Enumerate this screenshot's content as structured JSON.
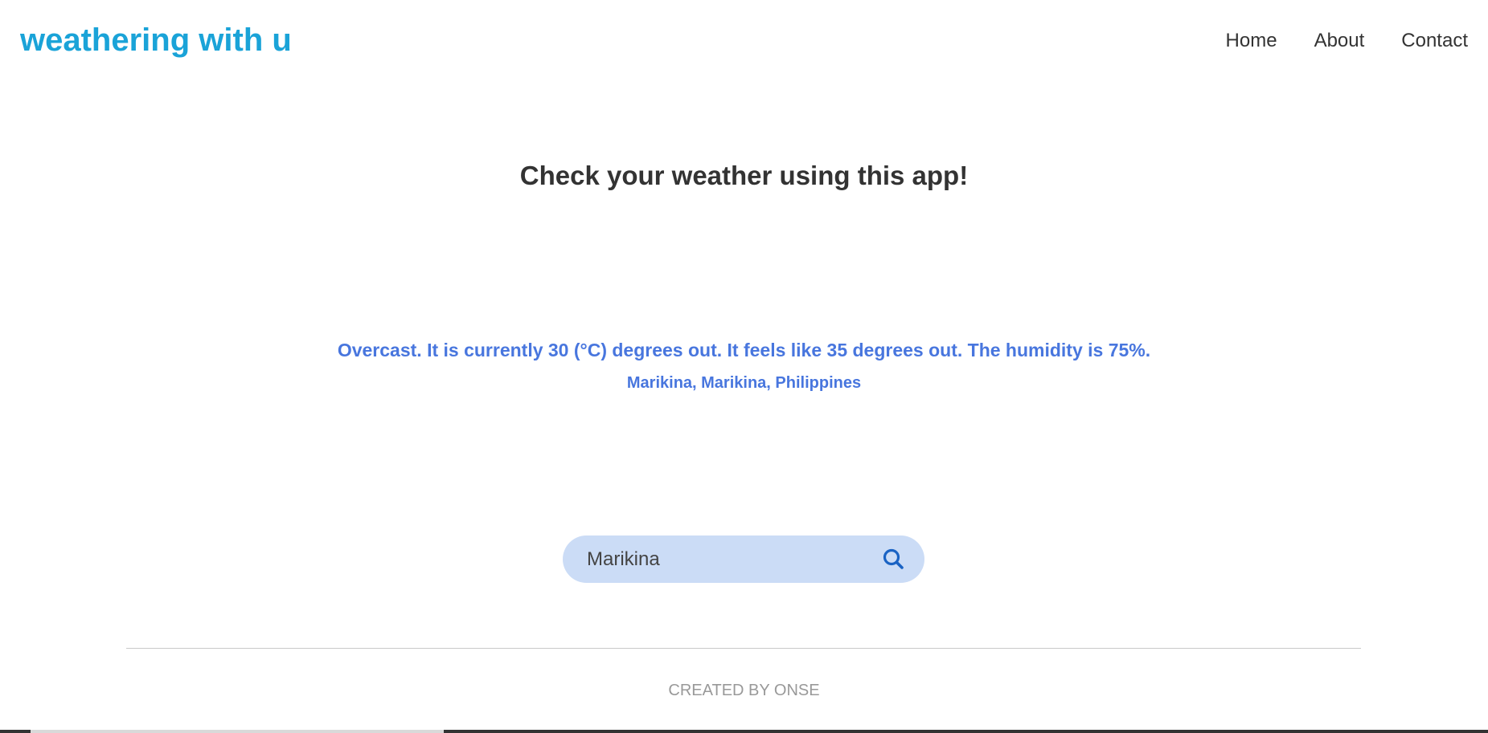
{
  "brand": {
    "title": "weathering with u",
    "color": "#1aa3d8"
  },
  "nav": {
    "items": [
      {
        "label": "Home"
      },
      {
        "label": "About"
      },
      {
        "label": "Contact"
      }
    ]
  },
  "main": {
    "headline": "Check your weather using this app!",
    "weather": {
      "summary": "Overcast. It is currently 30 (°C) degrees out. It feels like 35 degrees out. The humidity is 75%.",
      "location": "Marikina, Marikina, Philippines",
      "text_color": "#4876de"
    },
    "search": {
      "value": "Marikina",
      "icon": "search-icon",
      "background_color": "#cbdcf6",
      "icon_color": "#1a63c4"
    }
  },
  "footer": {
    "credit": "CREATED BY ONSE"
  }
}
